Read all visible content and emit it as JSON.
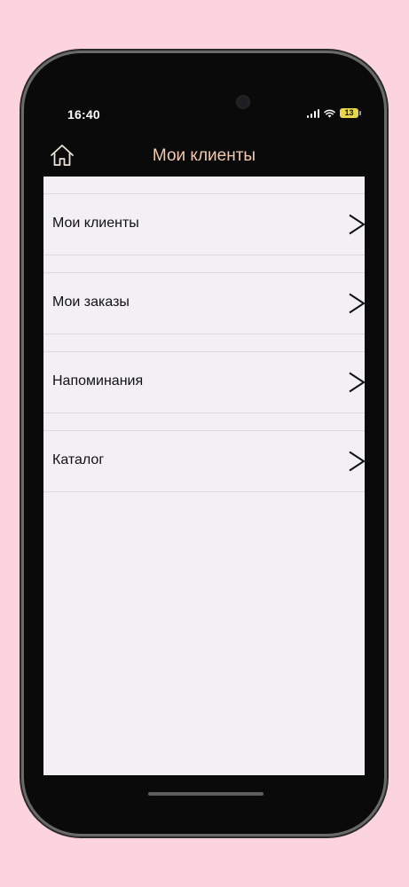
{
  "status_bar": {
    "time": "16:40",
    "battery": "13",
    "battery_color": "#e6d84a"
  },
  "nav": {
    "title": "Мои клиенты",
    "home_icon": "home-icon",
    "title_color": "#f2c9b0"
  },
  "menu": {
    "items": [
      {
        "label": "Мои клиенты",
        "icon": "chevron-right-icon"
      },
      {
        "label": "Мои заказы",
        "icon": "chevron-right-icon"
      },
      {
        "label": "Напоминания",
        "icon": "chevron-right-icon"
      },
      {
        "label": "Каталог",
        "icon": "chevron-right-icon"
      }
    ]
  },
  "colors": {
    "page_background": "#fbd4de",
    "content_background": "#f2f0f4",
    "phone_frame": "#0a0a0a"
  }
}
